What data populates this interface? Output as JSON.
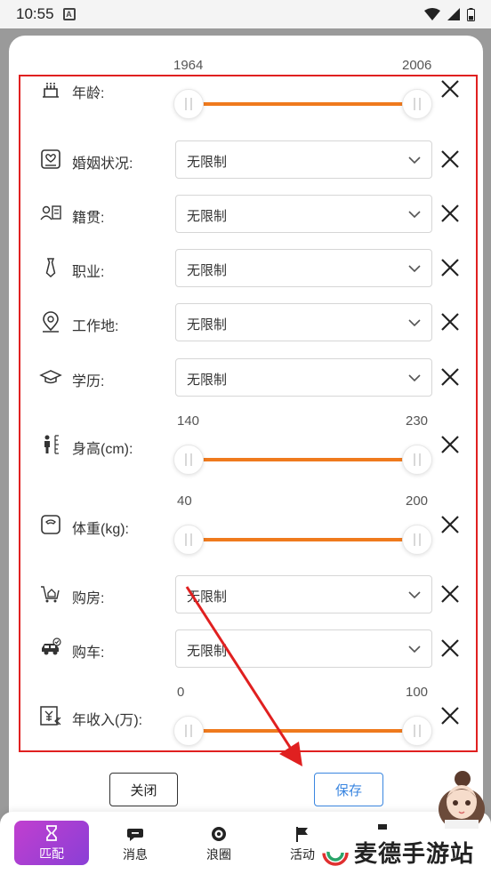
{
  "status": {
    "time": "10:55",
    "a_icon": "A"
  },
  "rows": [
    {
      "key": "age",
      "label": "年龄:",
      "icon": "cake-icon",
      "kind": "range",
      "min": "1964",
      "max": "2006",
      "low": 0,
      "high": 1
    },
    {
      "key": "marital",
      "label": "婚姻状况:",
      "icon": "marriage-certificate-icon",
      "kind": "select",
      "value": "无限制"
    },
    {
      "key": "native",
      "label": "籍贯:",
      "icon": "id-card-icon",
      "kind": "select",
      "value": "无限制"
    },
    {
      "key": "job",
      "label": "职业:",
      "icon": "necktie-icon",
      "kind": "select",
      "value": "无限制"
    },
    {
      "key": "workplace",
      "label": "工作地:",
      "icon": "location-pin-icon",
      "kind": "select",
      "value": "无限制"
    },
    {
      "key": "edu",
      "label": "学历:",
      "icon": "graduation-cap-icon",
      "kind": "select",
      "value": "无限制"
    },
    {
      "key": "height",
      "label": "身高(cm):",
      "icon": "height-ruler-icon",
      "kind": "range",
      "min": "140",
      "max": "230",
      "low": 0,
      "high": 1
    },
    {
      "key": "weight",
      "label": "体重(kg):",
      "icon": "weight-scale-icon",
      "kind": "range",
      "min": "40",
      "max": "200",
      "low": 0,
      "high": 1
    },
    {
      "key": "house",
      "label": "购房:",
      "icon": "house-cart-icon",
      "kind": "select",
      "value": "无限制"
    },
    {
      "key": "car",
      "label": "购车:",
      "icon": "car-icon",
      "kind": "select",
      "value": "无限制"
    },
    {
      "key": "income",
      "label": "年收入(万):",
      "icon": "yuan-income-icon",
      "kind": "range",
      "min": "0",
      "max": "100",
      "low": 0,
      "high": 1
    }
  ],
  "buttons": {
    "close": "关闭",
    "save": "保存"
  },
  "tabs": [
    {
      "label": "匹配",
      "icon": "hourglass-icon",
      "active": true
    },
    {
      "label": "消息",
      "icon": "chat-bubble-icon",
      "active": false
    },
    {
      "label": "浪圈",
      "icon": "target-circle-icon",
      "active": false
    },
    {
      "label": "活动",
      "icon": "flag-icon",
      "active": false
    }
  ],
  "watermark": "麦德手游站",
  "colors": {
    "accent_orange": "#ef7a1d",
    "frame_red": "#e02020",
    "save_blue": "#3a86e0",
    "tab_active": "#a03fd4"
  }
}
